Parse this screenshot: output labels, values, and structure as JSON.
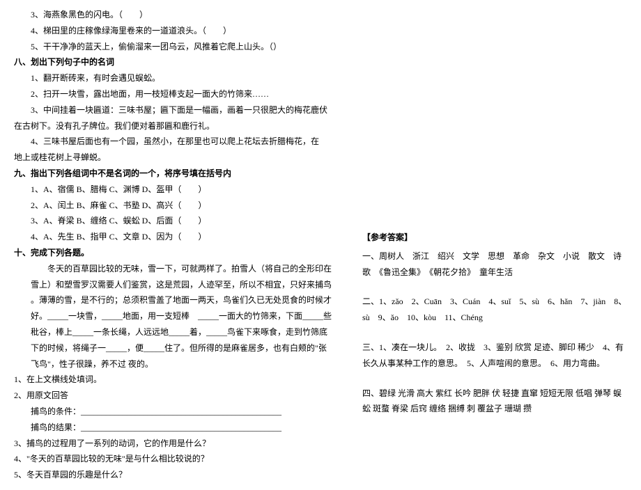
{
  "left": {
    "lines_top": [
      "3、海燕象黑色的闪电。（　　）",
      "4、梯田里的庄稼像绿海里卷来的一道道浪头。（　　）",
      "5、干干净净的蓝天上，偷偷溜来一团乌云，风推着它爬上山头。（）"
    ],
    "h8": "八、划出下列句子中的名词",
    "sec8": [
      "1、翻开断砖来，有时会遇见蜈蚣。",
      "2、扫开一块雪，露出地面，用一枝短棒支起一面大的竹筛来……",
      "3、中间挂着一块匾道：三味书屋；匾下面是一幅画，画着一只很肥大的梅花鹿伏"
    ],
    "sec8b": "在古树下。没有孔子牌位。我们便对着那匾和鹿行礼。",
    "sec8c": [
      "4、三味书屋后面也有一个园，虽然小，在那里也可以爬上花坛去折腊梅花，在"
    ],
    "sec8d": "地上或桂花树上寻蝉蜕。",
    "h9": "九、指出下列各组词中不是名词的一个，将序号填在括号内",
    "sec9": [
      "1、A、宿儒  B、腊梅  C、渊博  D、盔甲（　　）",
      "2、A、闰土  B、麻雀  C、书塾  D、高兴（　　）",
      "3、A、脊梁  B、缠络  C、蜈蚣  D、后面（　　）",
      "4、A、先生  B、指甲  C、文章  D、因为（　　）"
    ],
    "h10": "十、完成下列各题。",
    "p10_1": "　　冬天的百草园比较的无味，雪一下，可就两样了。拍雪人（将自己的全形印在 雪上）和塑雪罗汉需要人们鉴赏，这是荒园，人迹罕至，所以不相宜，只好来捕鸟 。薄薄的雪，是不行的；总须积雪盖了地面一两天，鸟雀们久已无处觅食的时候才好。_____一块雪，_____地面，用一支短棒　_____一面大的竹筛来，下面_____些 秕谷，棒上_____一条长绳，人远远地_____着，_____鸟雀下来啄食，走到竹筛底下的时候，将绳子一_____，便_____住了。但所得的是麻雀居多，也有白颊的\"张飞鸟\"，性子很躁，养不过 夜的。",
    "q1": "1、在上文横线处填词。",
    "q2a": "2、用原文回答",
    "q2b": "捕鸟的条件：________________________________________________",
    "q2c": "捕鸟的结果：________________________________________________",
    "q3": "3、捕鸟的过程用了一系列的动词，它的作用是什么？",
    "q4": "4、\"冬天的百草园比较的无味\"是与什么相比较说的？",
    "q5": "5、冬天百草园的乐趣是什么？"
  },
  "right": {
    "title": "【参考答案】",
    "a1": "一、周树人　浙江　绍兴　文学　思想　革命　杂文　小说　散文　诗歌　《鲁迅全集》　《朝花夕拾》　童年生活",
    "a2": "二、1、zǎo　2、Cuān　3、Cuán　4、suǐ　5、sù　6、hǎn　7、jiàn　8、sù　9、ǎo　10、kòu　11、Chéng",
    "a3": "三、1、凑在一块儿。　2、收拢　3、鉴别 欣赏 足迹、脚印 稀少　4、有长久从事某种工作的意思。　5、人声喧闹的意思。　6、用力弯曲。",
    "a4": "四、碧绿 光滑 高大 紫红 长吟 肥胖 伏 轻捷 直窜 短短无限 低唱 弹琴 蜈蚣 斑蝥 脊梁 后窍 缠络 捆缚 刺 覆盆子 珊瑚 攒"
  }
}
